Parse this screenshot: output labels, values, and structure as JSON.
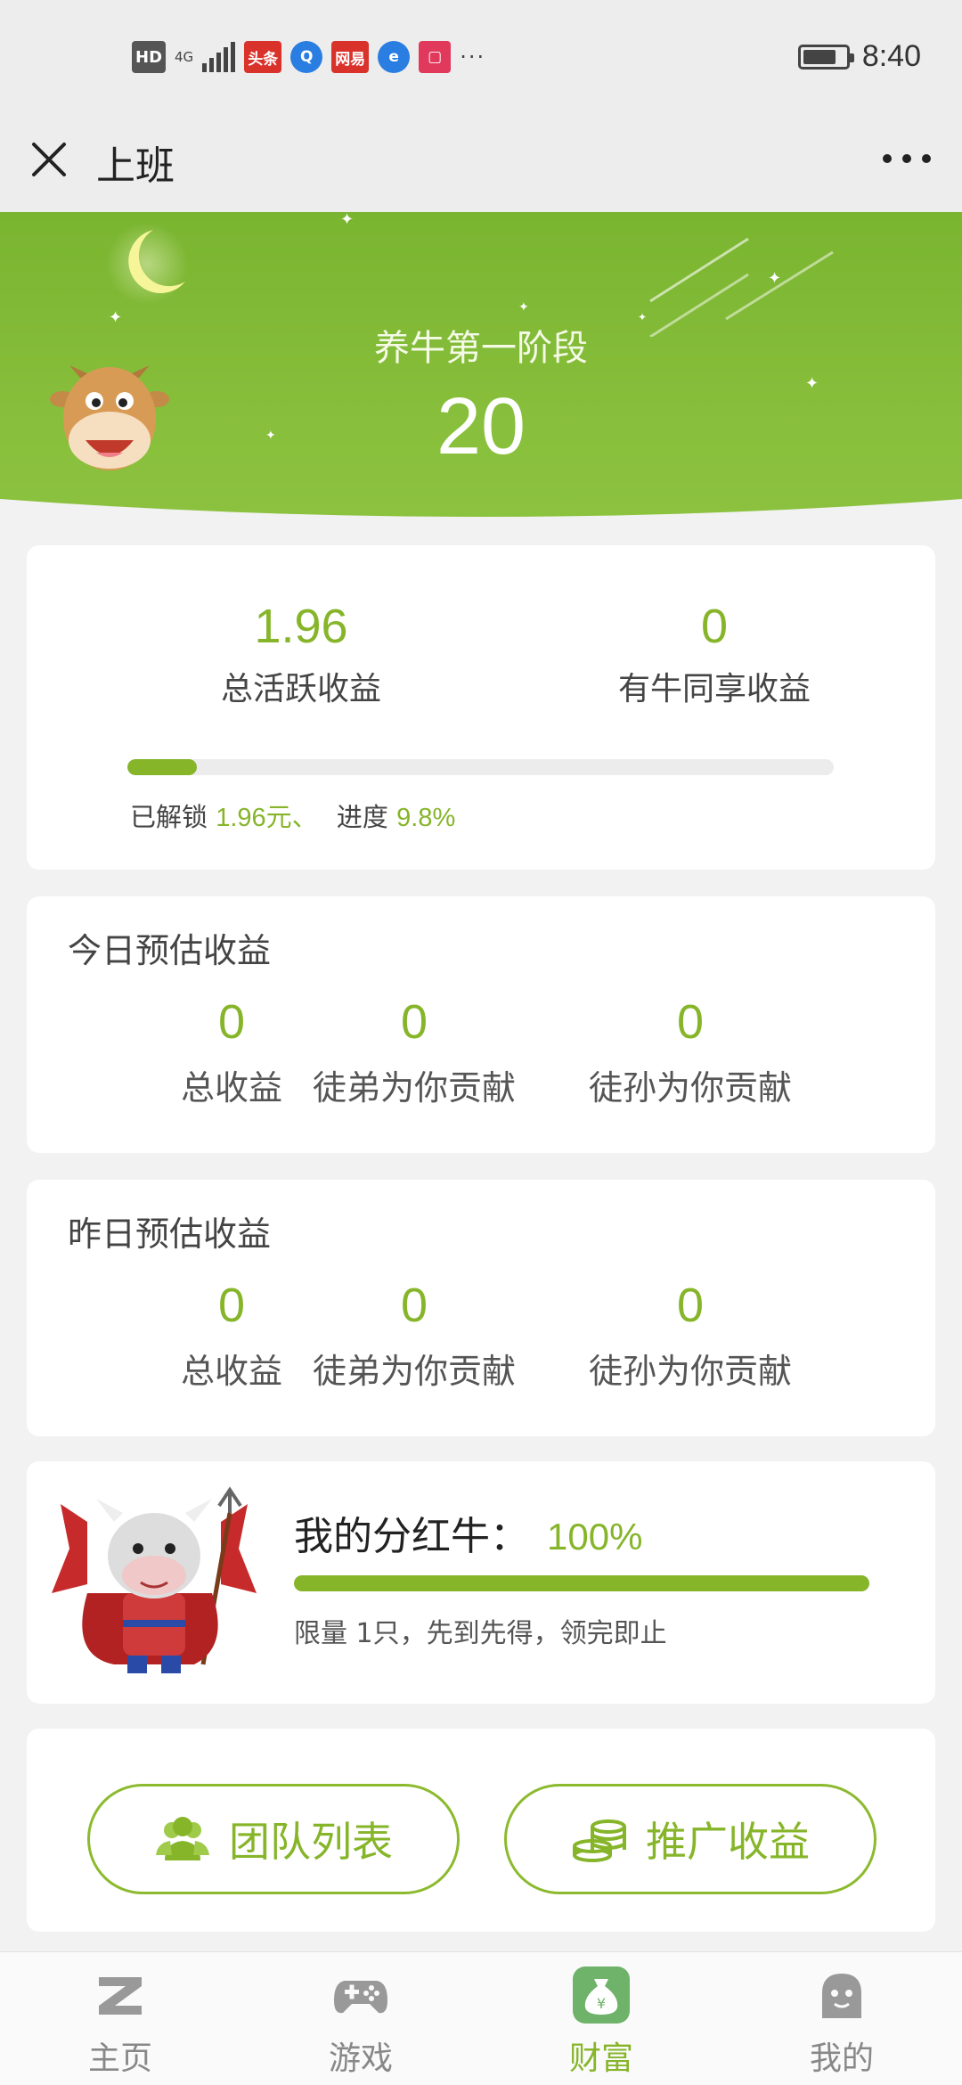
{
  "status_bar": {
    "hd": "HD",
    "network": "4G",
    "app_badges": [
      "头条",
      "网易"
    ],
    "more": "···",
    "time": "8:40"
  },
  "title_bar": {
    "title": "上班"
  },
  "hero": {
    "stage_title": "养牛第一阶段",
    "stage_number": "20"
  },
  "activity": {
    "total_value": "1.96",
    "total_label": "总活跃收益",
    "shared_value": "0",
    "shared_label": "有牛同享收益",
    "progress_fraction": 0.098,
    "unlocked_prefix": "已解锁",
    "unlocked_value": "1.96元、",
    "progress_prefix": "进度",
    "progress_value": "9.8%"
  },
  "today": {
    "title": "今日预估收益",
    "items": [
      {
        "value": "0",
        "label": "总收益"
      },
      {
        "value": "0",
        "label": "徒弟为你贡献"
      },
      {
        "value": "0",
        "label": "徒孙为你贡献"
      }
    ]
  },
  "yesterday": {
    "title": "昨日预估收益",
    "items": [
      {
        "value": "0",
        "label": "总收益"
      },
      {
        "value": "0",
        "label": "徒弟为你贡献"
      },
      {
        "value": "0",
        "label": "徒孙为你贡献"
      }
    ]
  },
  "bull": {
    "title": "我的分红牛：",
    "percent": "100%",
    "progress_fraction": 1.0,
    "note": "限量 1只，先到先得，领完即止"
  },
  "actions": {
    "team_label": "团队列表",
    "promo_label": "推广收益"
  },
  "tabs": [
    {
      "label": "主页",
      "icon": "home-z-icon"
    },
    {
      "label": "游戏",
      "icon": "gamepad-icon"
    },
    {
      "label": "财富",
      "icon": "money-bag-icon",
      "active": true
    },
    {
      "label": "我的",
      "icon": "ghost-face-icon"
    }
  ],
  "colors": {
    "accent": "#86b52a",
    "hero_green": "#7ab530"
  }
}
